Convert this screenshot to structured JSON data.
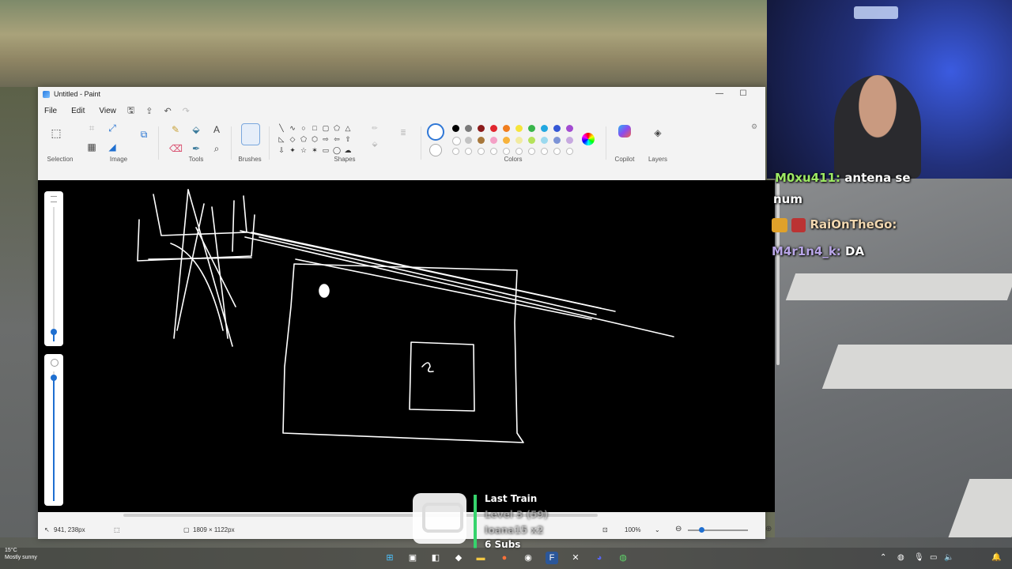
{
  "window": {
    "title": "Untitled - Paint"
  },
  "menu": {
    "file": "File",
    "edit": "Edit",
    "view": "View"
  },
  "ribbon": {
    "selection": "Selection",
    "image": "Image",
    "tools": "Tools",
    "brushes": "Brushes",
    "shapes": "Shapes",
    "colors": "Colors",
    "copilot": "Copilot",
    "layers": "Layers"
  },
  "palette": {
    "row1": [
      "#000000",
      "#7a7a7a",
      "#8b1b1b",
      "#e0262e",
      "#f07d1e",
      "#f6e43a",
      "#38b54a",
      "#22a7e0",
      "#3457d5",
      "#a24bd1"
    ],
    "row2": [
      "#ffffff",
      "#c3c3c3",
      "#a7773b",
      "#f4a0c6",
      "#f7b23b",
      "#f2eba0",
      "#b5e25a",
      "#9bd9ef",
      "#7c93d6",
      "#c7a9e0"
    ]
  },
  "status": {
    "cursor_pos": "941, 238px",
    "canvas_size": "1809 × 1122px",
    "zoom": "100%"
  },
  "chat": [
    {
      "user": "M0xu411:",
      "text": "antena se"
    },
    {
      "user": "",
      "text": "num"
    },
    {
      "user": "RaiOnTheGo:",
      "text": ""
    },
    {
      "user": "M4r1n4_k:",
      "text": "DA"
    }
  ],
  "last_train": {
    "title": "Last Train",
    "level": "Level 3 (59)",
    "user": "Ioana15 x2",
    "subs": "6 Subs"
  },
  "weather": {
    "temp": "15°C",
    "desc": "Mostly sunny"
  }
}
